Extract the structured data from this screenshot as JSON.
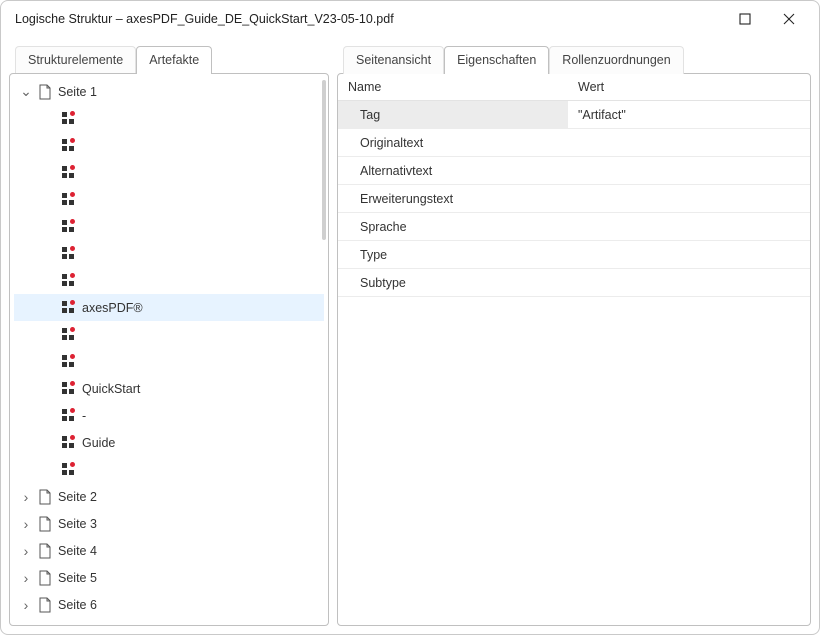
{
  "window": {
    "title": "Logische Struktur – axesPDF_Guide_DE_QuickStart_V23-05-10.pdf"
  },
  "left_tabs": [
    {
      "label": "Strukturelemente",
      "active": false
    },
    {
      "label": "Artefakte",
      "active": true
    }
  ],
  "right_tabs": [
    {
      "label": "Seitenansicht",
      "active": false
    },
    {
      "label": "Eigenschaften",
      "active": true
    },
    {
      "label": "Rollenzuordnungen",
      "active": false
    }
  ],
  "tree": {
    "page1_label": "Seite 1",
    "page1_expanded": true,
    "page1_children": [
      {
        "label": ""
      },
      {
        "label": ""
      },
      {
        "label": ""
      },
      {
        "label": ""
      },
      {
        "label": ""
      },
      {
        "label": ""
      },
      {
        "label": ""
      },
      {
        "label": "axesPDF®",
        "selected": true
      },
      {
        "label": ""
      },
      {
        "label": ""
      },
      {
        "label": "QuickStart"
      },
      {
        "label": "-"
      },
      {
        "label": "Guide"
      },
      {
        "label": ""
      }
    ],
    "other_pages": [
      {
        "label": "Seite 2"
      },
      {
        "label": "Seite 3"
      },
      {
        "label": "Seite 4"
      },
      {
        "label": "Seite 5"
      },
      {
        "label": "Seite 6"
      }
    ]
  },
  "properties": {
    "header_name": "Name",
    "header_value": "Wert",
    "rows": [
      {
        "name": "Tag",
        "value": "\"Artifact\"",
        "selected": true
      },
      {
        "name": "Originaltext",
        "value": ""
      },
      {
        "name": "Alternativtext",
        "value": ""
      },
      {
        "name": "Erweiterungstext",
        "value": ""
      },
      {
        "name": "Sprache",
        "value": ""
      },
      {
        "name": "Type",
        "value": ""
      },
      {
        "name": "Subtype",
        "value": ""
      }
    ]
  }
}
